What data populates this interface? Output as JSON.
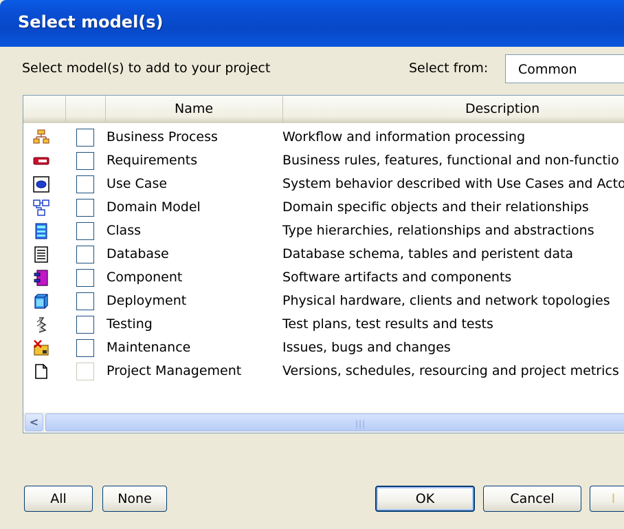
{
  "window": {
    "title": "Select model(s)"
  },
  "prompt": "Select model(s) to add to your project",
  "select_from": {
    "label": "Select from:",
    "value": "Common"
  },
  "table": {
    "columns": {
      "icon": "",
      "check": "",
      "name": "Name",
      "description": "Description"
    },
    "rows": [
      {
        "icon": "business-process-icon",
        "name": "Business Process",
        "description": "Workflow and information processing",
        "checked": false,
        "enabled": true
      },
      {
        "icon": "requirements-icon",
        "name": "Requirements",
        "description": "Business rules, features, functional and non-functio",
        "checked": false,
        "enabled": true
      },
      {
        "icon": "use-case-icon",
        "name": "Use Case",
        "description": "System behavior described with Use Cases and Acto",
        "checked": false,
        "enabled": true
      },
      {
        "icon": "domain-model-icon",
        "name": "Domain Model",
        "description": "Domain specific objects and their relationships",
        "checked": false,
        "enabled": true
      },
      {
        "icon": "class-icon",
        "name": "Class",
        "description": "Type hierarchies, relationships and abstractions",
        "checked": false,
        "enabled": true
      },
      {
        "icon": "database-icon",
        "name": "Database",
        "description": "Database schema, tables and peristent data",
        "checked": false,
        "enabled": true
      },
      {
        "icon": "component-icon",
        "name": "Component",
        "description": "Software artifacts and components",
        "checked": false,
        "enabled": true
      },
      {
        "icon": "deployment-icon",
        "name": "Deployment",
        "description": "Physical hardware, clients and network topologies",
        "checked": false,
        "enabled": true
      },
      {
        "icon": "testing-icon",
        "name": "Testing",
        "description": "Test plans, test results and tests",
        "checked": false,
        "enabled": true
      },
      {
        "icon": "maintenance-icon",
        "name": "Maintenance",
        "description": "Issues, bugs and changes",
        "checked": false,
        "enabled": true
      },
      {
        "icon": "project-management-icon",
        "name": "Project Management",
        "description": "Versions, schedules, resourcing and project metrics",
        "checked": false,
        "enabled": false
      }
    ]
  },
  "scrollbar": {
    "left_arrow": "<",
    "grip": "|||"
  },
  "buttons": {
    "all": "All",
    "none": "None",
    "ok": "OK",
    "cancel": "Cancel",
    "help_partial": "I"
  },
  "colors": {
    "titlebar": "#0a4fd6",
    "dialog_bg": "#ece9d8",
    "button_border": "#003c74"
  }
}
